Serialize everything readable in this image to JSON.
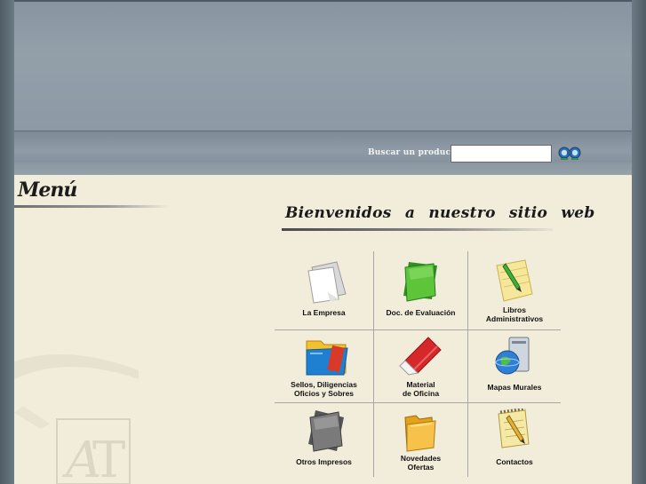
{
  "search": {
    "label": "Buscar un producto:",
    "value": "",
    "placeholder": ""
  },
  "menu": {
    "title": "Menú",
    "items": []
  },
  "welcome": {
    "title": "Bienvenidos a nuestro sitio web"
  },
  "sections": [
    {
      "label": "La Empresa",
      "icon": "document-pages-icon"
    },
    {
      "label": "Doc. de Evaluación",
      "icon": "green-folder-icon"
    },
    {
      "label": "Libros\nAdministrativos",
      "icon": "notepad-pencil-icon"
    },
    {
      "label": "Sellos, Diligencias\nOficios y Sobres",
      "icon": "folder-stamp-icon"
    },
    {
      "label": "Material\nde Oficina",
      "icon": "eraser-icon"
    },
    {
      "label": "Mapas Murales",
      "icon": "globe-computer-icon"
    },
    {
      "label": "Otros Impresos",
      "icon": "gray-folder-icon"
    },
    {
      "label": "Novedades\nOfertas",
      "icon": "yellow-folder-icon"
    },
    {
      "label": "Contactos",
      "icon": "notepad-contacts-icon"
    }
  ],
  "colors": {
    "header": "#939fa9",
    "content_background": "#f2ecdb",
    "grid_lines": "#a8a8a8"
  }
}
